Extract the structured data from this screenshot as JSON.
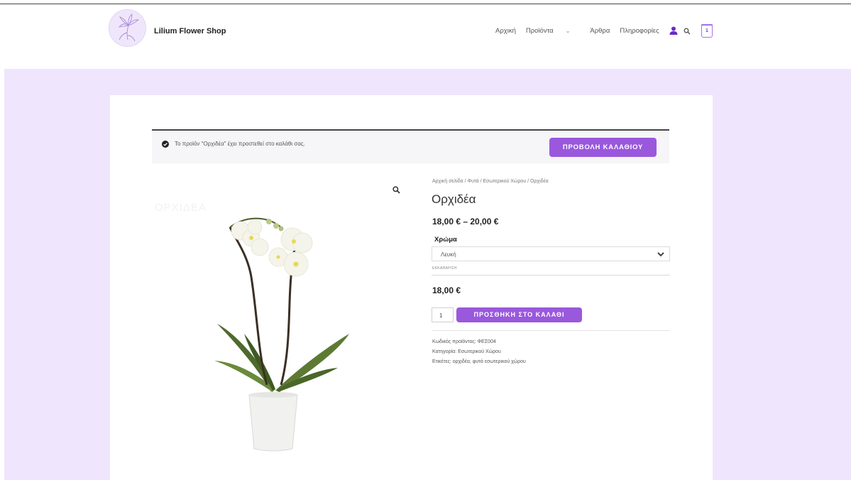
{
  "site": {
    "brand": "Lilium Flower Shop"
  },
  "nav": {
    "items": [
      "Αρχική",
      "Προϊόντα",
      "Άρθρα",
      "Πληροφορίες"
    ],
    "cart_count": "1"
  },
  "notice": {
    "message": "Το προϊόν “Ορχιδέα” έχει προστεθεί στο καλάθι σας.",
    "view_cart_label": "ΠΡΟΒΟΛΗ ΚΑΛΑΘΙΟΥ"
  },
  "product": {
    "breadcrumb": "Αρχική σελίδα / Φυτά / Εσωτερικού Χώρου / Ορχιδέα",
    "title": "Ορχιδέα",
    "price_range": "18,00 € – 20,00 €",
    "option_label": "Χρώμα",
    "option_value": "Λευκή",
    "clear_label": "ΕΚΚΑΘΑΡΙΣΗ",
    "variation_price": "18,00 €",
    "quantity": "1",
    "add_to_cart_label": "ΠΡΟΣΘΗΚΗ ΣΤΟ ΚΑΛΑΘΙ",
    "sku": "Κωδικός προϊόντος: ΦΕΣ004",
    "category": "Κατηγορία: Εσωτερικού Χώρου",
    "tags": "Ετικέτες: ορχιδέα, φυτά εσωτερικού χώρου",
    "image_ghost_text": "ΟΡΧΙΔΕΑ"
  },
  "colors": {
    "accent": "#9a58dd",
    "band": "#efe6fd"
  },
  "icons": {
    "logo": "lily-logo-icon",
    "user": "user-icon",
    "search": "search-icon",
    "cart": "cart-icon",
    "zoom": "zoom-icon",
    "notice": "check-circle-icon",
    "dropdown": "chevron-down-icon"
  }
}
